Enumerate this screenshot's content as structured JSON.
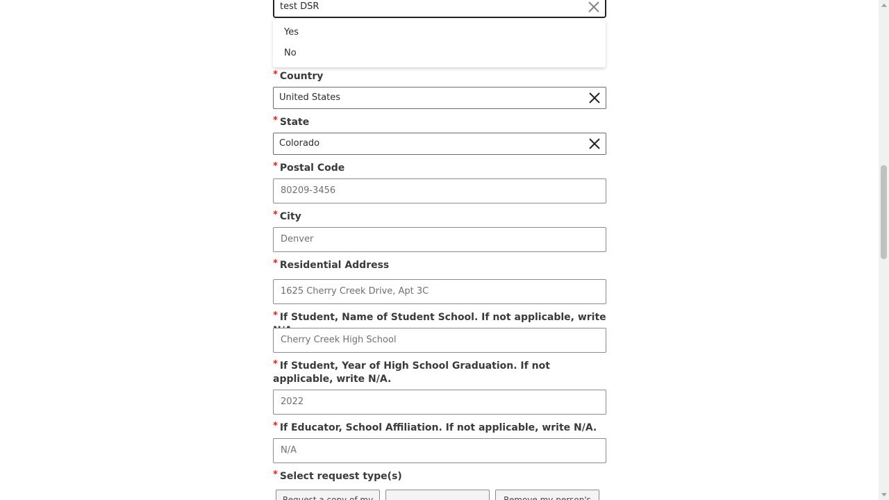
{
  "top_field": {
    "value": "test DSR"
  },
  "dropdown": {
    "options": [
      "Yes",
      "No"
    ]
  },
  "fields": {
    "country": {
      "label": "Country",
      "value": "United States"
    },
    "state": {
      "label": "State",
      "value": "Colorado"
    },
    "postal_code": {
      "label": "Postal Code",
      "value": "80209-3456"
    },
    "city": {
      "label": "City",
      "value": "Denver"
    },
    "residential_address": {
      "label": "Residential Address",
      "value": "1625 Cherry Creek Drive, Apt 3C"
    },
    "student_school": {
      "label": "If Student, Name of Student School. If not applicable, write N/A.",
      "value": "Cherry Creek High School"
    },
    "graduation_year": {
      "label": "If Student, Year of High School Graduation. If not applicable, write N/A.",
      "value": "2022"
    },
    "educator_affiliation": {
      "label": "If Educator, School Affiliation. If not applicable, write N/A.",
      "value": "N/A"
    },
    "request_types": {
      "label": "Select request type(s)"
    }
  },
  "request_buttons": [
    "Request a copy of my",
    "",
    "Remove my person's"
  ],
  "required_marker": "*"
}
